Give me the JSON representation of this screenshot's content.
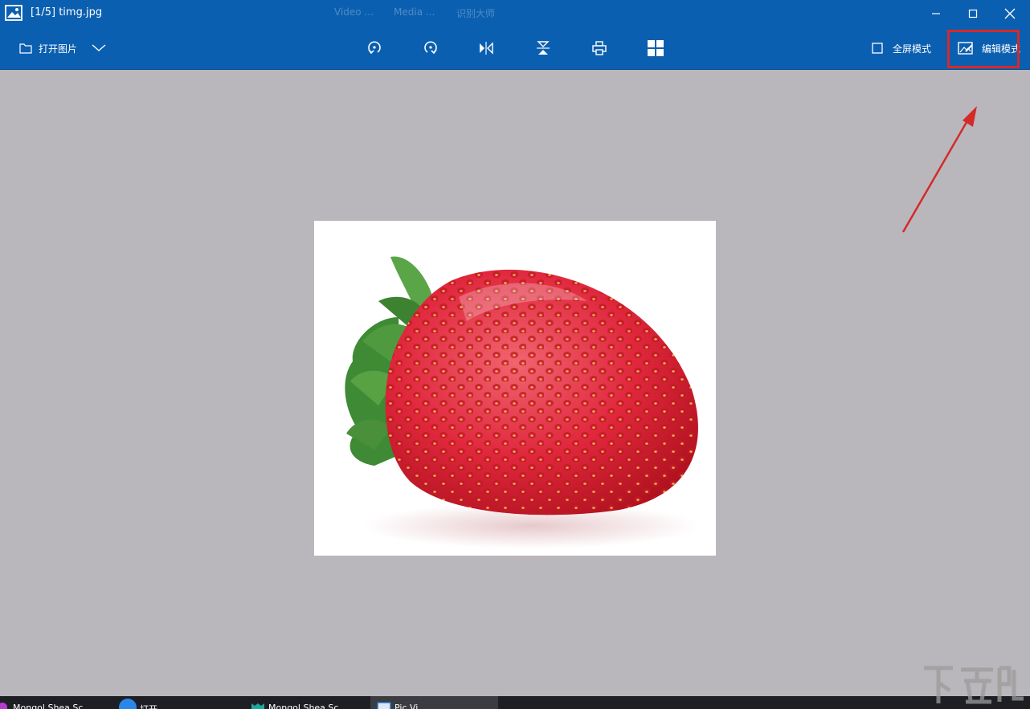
{
  "window": {
    "title": "[1/5]  timg.jpg",
    "ghost_tabs": [
      "Video ...",
      "Media ...",
      "识别大师"
    ]
  },
  "toolbar": {
    "open_label": "打开图片",
    "tools": [
      {
        "name": "rotate-left-icon"
      },
      {
        "name": "rotate-right-icon"
      },
      {
        "name": "flip-horizontal-icon"
      },
      {
        "name": "flip-vertical-icon"
      },
      {
        "name": "print-icon"
      },
      {
        "name": "grid-view-icon"
      }
    ],
    "fullscreen_label": "全屏模式",
    "edit_label": "编辑模式"
  },
  "taskbar": {
    "items": [
      "Mongol Shea Sc...",
      "打开...",
      "Mongol Shea Sc...",
      "Pic Vi..."
    ]
  },
  "colors": {
    "accent": "#0b5fb0",
    "canvas": "#b9b7bb",
    "annotation": "#d42a2a",
    "taskbar": "#1e1f24"
  }
}
